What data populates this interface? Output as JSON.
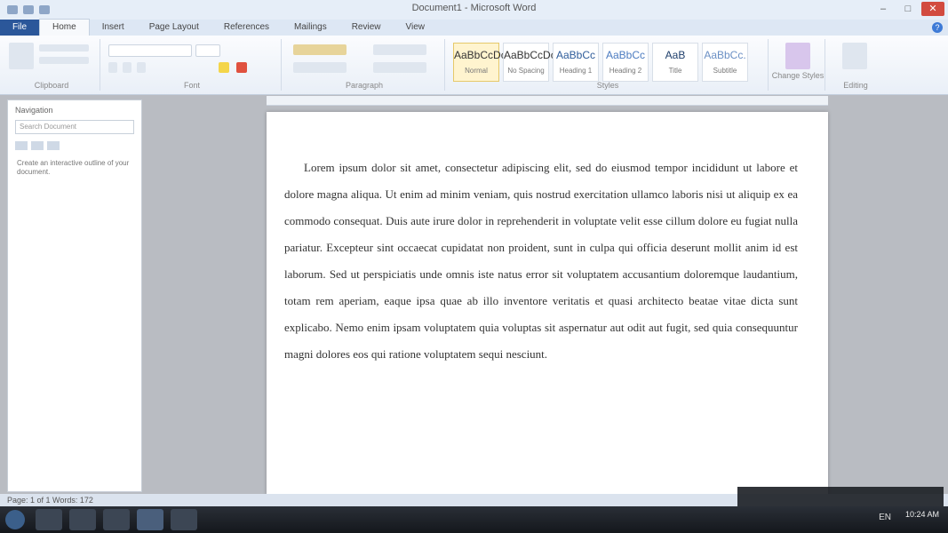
{
  "window": {
    "title": "Document1 - Microsoft Word"
  },
  "ribbon": {
    "file_tab": "File",
    "tabs": [
      "Home",
      "Insert",
      "Page Layout",
      "References",
      "Mailings",
      "Review",
      "View"
    ],
    "groups": [
      "Clipboard",
      "Font",
      "Paragraph",
      "Styles",
      "Editing"
    ],
    "styles": [
      {
        "sample": "AaBbCcDc",
        "name": "Normal"
      },
      {
        "sample": "AaBbCcDc",
        "name": "No Spacing"
      },
      {
        "sample": "AaBbCc",
        "name": "Heading 1"
      },
      {
        "sample": "AaBbCc",
        "name": "Heading 2"
      },
      {
        "sample": "AaB",
        "name": "Title"
      },
      {
        "sample": "AaBbCc.",
        "name": "Subtitle"
      }
    ],
    "change_styles": "Change Styles",
    "editing": "Editing"
  },
  "navigation": {
    "title": "Navigation",
    "search_placeholder": "Search Document",
    "text": "Create an interactive outline of your document."
  },
  "document": {
    "body": "Lorem ipsum dolor sit amet, consectetur adipiscing elit, sed do eiusmod tempor incididunt ut labore et dolore magna aliqua. Ut enim ad minim veniam, quis nostrud exercitation ullamco laboris nisi ut aliquip ex ea commodo consequat. Duis aute irure dolor in reprehenderit in voluptate velit esse cillum dolore eu fugiat nulla pariatur. Excepteur sint occaecat cupidatat non proident, sunt in culpa qui officia deserunt mollit anim id est laborum. Sed ut perspiciatis unde omnis iste natus error sit voluptatem accusantium doloremque laudantium, totam rem aperiam, eaque ipsa quae ab illo inventore veritatis et quasi architecto beatae vitae dicta sunt explicabo. Nemo enim ipsam voluptatem quia voluptas sit aspernatur aut odit aut fugit, sed quia consequuntur magni dolores eos qui ratione voluptatem sequi nesciunt."
  },
  "status": {
    "text": "Page: 1 of 1   Words: 172"
  },
  "taskbar": {
    "tray": "EN",
    "time": "10:24 AM"
  },
  "colors": {
    "file_tab": "#2b579a",
    "close_button": "#d24b3f",
    "taskbar": "#1f242b"
  }
}
